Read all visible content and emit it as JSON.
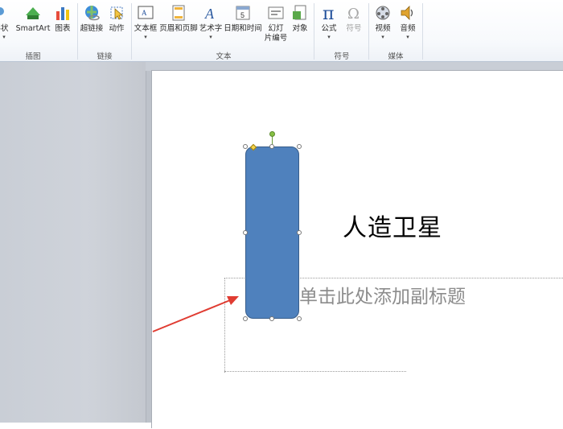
{
  "ribbon": {
    "groups": {
      "illustrations": "插图",
      "links": "链接",
      "text": "文本",
      "symbols": "符号",
      "media": "媒体"
    },
    "buttons": {
      "shapes": "形状",
      "smartart": "SmartArt",
      "chart": "图表",
      "hyperlink": "超链接",
      "action": "动作",
      "textbox": "文本框",
      "header_footer": "页眉和页脚",
      "wordart": "艺术字",
      "datetime": "日期和时间",
      "slide_number_1": "幻灯",
      "slide_number_2": "片编号",
      "object": "对象",
      "equation": "公式",
      "symbol": "符号",
      "video": "视频",
      "audio": "音频",
      "dropdown": "▾"
    }
  },
  "slide": {
    "title": "人造卫星",
    "subtitle_placeholder": "单击此处添加副标题"
  },
  "colors": {
    "shape_fill": "#4f81bd",
    "shape_border": "#385d8a",
    "arrow": "#e03c32"
  }
}
